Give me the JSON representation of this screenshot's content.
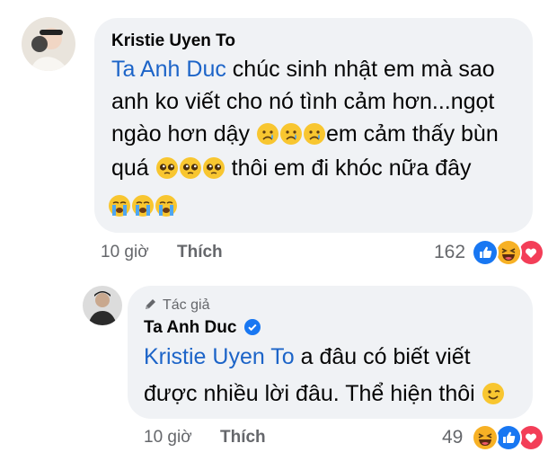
{
  "comment": {
    "author": "Kristie Uyen To",
    "mention": "Ta Anh Duc",
    "line1_rest": " chúc sinh nhật em mà sao",
    "line2": "anh ko viết cho nó tình cảm hơn...ngọt",
    "line3_pre": "ngào hơn dậy ",
    "line3_post": "em cảm thấy bùn",
    "line4_pre": "quá ",
    "line4_post": " thôi em đi khóc nữa đây",
    "time": "10 giờ",
    "like_label": "Thích",
    "reaction_count": "162",
    "reactions": [
      "like-icon",
      "haha-icon",
      "love-icon"
    ],
    "inline_emojis": [
      "crying-face-icon",
      "pleading-face-icon",
      "loudly-crying-face-icon"
    ]
  },
  "reply": {
    "badge": "Tác giả",
    "author": "Ta Anh Duc",
    "mention": "Kristie Uyen To",
    "line1_rest": " a đâu có biết viết",
    "line2": "được nhiều lời đâu. Thể hiện thôi ",
    "time": "10 giờ",
    "like_label": "Thích",
    "reaction_count": "49",
    "reactions": [
      "haha-icon",
      "like-icon",
      "love-icon"
    ],
    "inline_emojis": [
      "winking-face-icon"
    ]
  },
  "colors": {
    "bubble": "#f0f2f5",
    "mention": "#1c64c8",
    "meta": "#65676b",
    "like": "#1877f2",
    "love": "#f33e58",
    "haha": "#f7b125"
  }
}
